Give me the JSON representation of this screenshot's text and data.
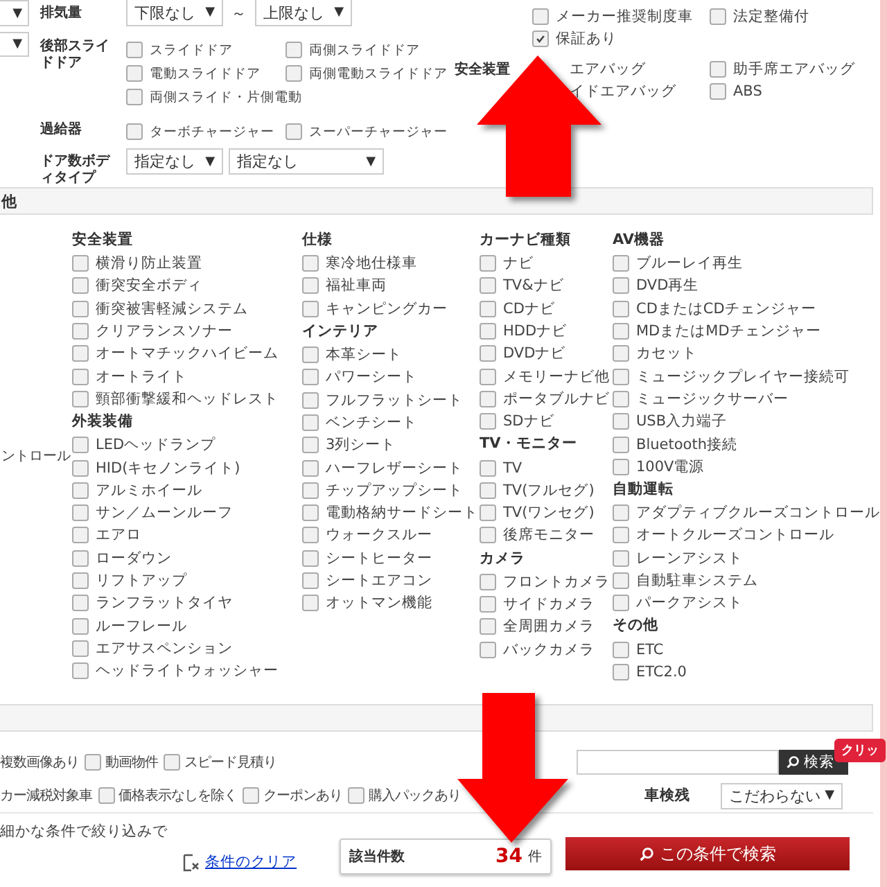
{
  "top_filters": {
    "stubs": [
      {
        "arrow": "▼"
      },
      {
        "arrow": "▼"
      }
    ],
    "rows": [
      {
        "kind": "range",
        "label": "排気量",
        "from": {
          "value": "下限なし",
          "arrow": "▼"
        },
        "separator": "～",
        "to": {
          "value": "上限なし",
          "arrow": "▼"
        }
      },
      {
        "kind": "checks",
        "label": "後部スライドドア",
        "options": [
          {
            "label": "スライドドア",
            "checked": false
          },
          {
            "label": "両側スライドドア",
            "checked": false
          },
          {
            "label": "電動スライドドア",
            "checked": false
          },
          {
            "label": "両側電動スライドドア",
            "checked": false
          },
          {
            "label": "両側スライド・片側電動",
            "checked": false
          }
        ]
      },
      {
        "kind": "checks",
        "label": "過給器",
        "options": [
          {
            "label": "ターボチャージャー",
            "checked": false
          },
          {
            "label": "スーパーチャージャー",
            "checked": false
          }
        ]
      },
      {
        "kind": "selects",
        "label": "ドア数ボディタイプ",
        "selects": [
          {
            "value": "指定なし",
            "arrow": "▼"
          },
          {
            "value": "指定なし",
            "arrow": "▼"
          }
        ]
      }
    ]
  },
  "right_rows": [
    {
      "options": [
        {
          "kind": "check",
          "label": "メーカー推奨制度車",
          "checked": false
        },
        {
          "kind": "check",
          "label": "法定整備付",
          "checked": false
        }
      ]
    },
    {
      "options": [
        {
          "kind": "check",
          "label": "保証あり",
          "checked": true
        }
      ]
    },
    {
      "label": "安全装置",
      "options": [
        {
          "kind": "covered",
          "label": "エアバッグ"
        },
        {
          "kind": "check",
          "label": "助手席エアバッグ",
          "checked": false
        }
      ]
    },
    {
      "options": [
        {
          "kind": "covered",
          "label": "イドエアバッグ"
        },
        {
          "kind": "check",
          "label": "ABS",
          "checked": false
        }
      ]
    }
  ],
  "section_header": "他",
  "side_text": "ントロール",
  "columns": [
    [
      {
        "title": "安全装置",
        "items": [
          {
            "label": "横滑り防止装置",
            "checked": false
          },
          {
            "label": "衝突安全ボディ",
            "checked": false
          },
          {
            "label": "衝突被害軽減システム",
            "checked": false
          },
          {
            "label": "クリアランスソナー",
            "checked": false
          },
          {
            "label": "オートマチックハイビーム",
            "checked": false
          },
          {
            "label": "オートライト",
            "checked": false
          },
          {
            "label": "頸部衝撃緩和ヘッドレスト",
            "checked": false
          }
        ]
      },
      {
        "title": "外装装備",
        "items": [
          {
            "label": "LEDヘッドランプ",
            "checked": false
          },
          {
            "label": "HID(キセノンライト)",
            "checked": false
          },
          {
            "label": "アルミホイール",
            "checked": false
          },
          {
            "label": "サン／ムーンルーフ",
            "checked": false
          },
          {
            "label": "エアロ",
            "checked": false
          },
          {
            "label": "ローダウン",
            "checked": false
          },
          {
            "label": "リフトアップ",
            "checked": false
          },
          {
            "label": "ランフラットタイヤ",
            "checked": false
          },
          {
            "label": "ルーフレール",
            "checked": false
          },
          {
            "label": "エアサスペンション",
            "checked": false
          },
          {
            "label": "ヘッドライトウォッシャー",
            "checked": false
          }
        ]
      }
    ],
    [
      {
        "title": "仕様",
        "items": [
          {
            "label": "寒冷地仕様車",
            "checked": false
          },
          {
            "label": "福祉車両",
            "checked": false
          },
          {
            "label": "キャンピングカー",
            "checked": false
          }
        ]
      },
      {
        "title": "インテリア",
        "items": [
          {
            "label": "本革シート",
            "checked": false
          },
          {
            "label": "パワーシート",
            "checked": false
          },
          {
            "label": "フルフラットシート",
            "checked": false
          },
          {
            "label": "ベンチシート",
            "checked": false
          },
          {
            "label": "3列シート",
            "checked": false
          },
          {
            "label": "ハーフレザーシート",
            "checked": false
          },
          {
            "label": "チップアップシート",
            "checked": false
          },
          {
            "label": "電動格納サードシート",
            "checked": false
          },
          {
            "label": "ウォークスルー",
            "checked": false
          },
          {
            "label": "シートヒーター",
            "checked": false
          },
          {
            "label": "シートエアコン",
            "checked": false
          },
          {
            "label": "オットマン機能",
            "checked": false
          }
        ]
      }
    ],
    [
      {
        "title": "カーナビ種類",
        "items": [
          {
            "label": "ナビ",
            "checked": false
          },
          {
            "label": "TV&ナビ",
            "checked": false
          },
          {
            "label": "CDナビ",
            "checked": false
          },
          {
            "label": "HDDナビ",
            "checked": false
          },
          {
            "label": "DVDナビ",
            "checked": false
          },
          {
            "label": "メモリーナビ他",
            "checked": false
          },
          {
            "label": "ポータブルナビ",
            "checked": false
          },
          {
            "label": "SDナビ",
            "checked": false
          }
        ]
      },
      {
        "title": "TV・モニター",
        "items": [
          {
            "label": "TV",
            "checked": false
          },
          {
            "label": "TV(フルセグ)",
            "checked": false
          },
          {
            "label": "TV(ワンセグ)",
            "checked": false
          },
          {
            "label": "後席モニター",
            "checked": false
          }
        ]
      },
      {
        "title": "カメラ",
        "items": [
          {
            "label": "フロントカメラ",
            "checked": false
          },
          {
            "label": "サイドカメラ",
            "checked": false
          },
          {
            "label": "全周囲カメラ",
            "checked": false
          },
          {
            "label": "バックカメラ",
            "checked": false
          }
        ]
      }
    ],
    [
      {
        "title": "AV機器",
        "items": [
          {
            "label": "ブルーレイ再生",
            "checked": false
          },
          {
            "label": "DVD再生",
            "checked": false
          },
          {
            "label": "CDまたはCDチェンジャー",
            "checked": false
          },
          {
            "label": "MDまたはMDチェンジャー",
            "checked": false
          },
          {
            "label": "カセット",
            "checked": false
          },
          {
            "label": "ミュージックプレイヤー接続可",
            "checked": false
          },
          {
            "label": "ミュージックサーバー",
            "checked": false
          },
          {
            "label": "USB入力端子",
            "checked": false
          },
          {
            "label": "Bluetooth接続",
            "checked": false
          },
          {
            "label": "100V電源",
            "checked": false
          }
        ]
      },
      {
        "title": "自動運転",
        "items": [
          {
            "label": "アダプティブクルーズコントロール",
            "checked": false
          },
          {
            "label": "オートクルーズコントロール",
            "checked": false
          },
          {
            "label": "レーンアシスト",
            "checked": false
          },
          {
            "label": "自動駐車システム",
            "checked": false
          },
          {
            "label": "パークアシスト",
            "checked": false
          }
        ]
      },
      {
        "title": "その他",
        "items": [
          {
            "label": "ETC",
            "checked": false
          },
          {
            "label": "ETC2.0",
            "checked": false
          }
        ]
      }
    ]
  ],
  "extra_rows": [
    [
      {
        "kind": "cut",
        "label": "複数画像あり"
      },
      {
        "kind": "check",
        "label": "動画物件",
        "checked": false
      },
      {
        "kind": "check",
        "label": "スピード見積り",
        "checked": false
      }
    ],
    [
      {
        "kind": "cut",
        "label": "カー減税対象車"
      },
      {
        "kind": "check",
        "label": "価格表示なしを除く",
        "checked": false
      },
      {
        "kind": "check",
        "label": "クーポンあり",
        "checked": false
      },
      {
        "kind": "check",
        "label": "購入パックあり",
        "checked": false
      }
    ]
  ],
  "keyword_search": {
    "button": "検索",
    "badge": "クリッ"
  },
  "inspection": {
    "label": "車検残",
    "value": "こだわらない",
    "arrow": "▼"
  },
  "footer": {
    "note": "細かな条件で絞り込みで",
    "clear_link": "条件のクリア",
    "count_label": "該当件数",
    "count": "34",
    "unit": "件",
    "submit": "この条件で検索"
  }
}
